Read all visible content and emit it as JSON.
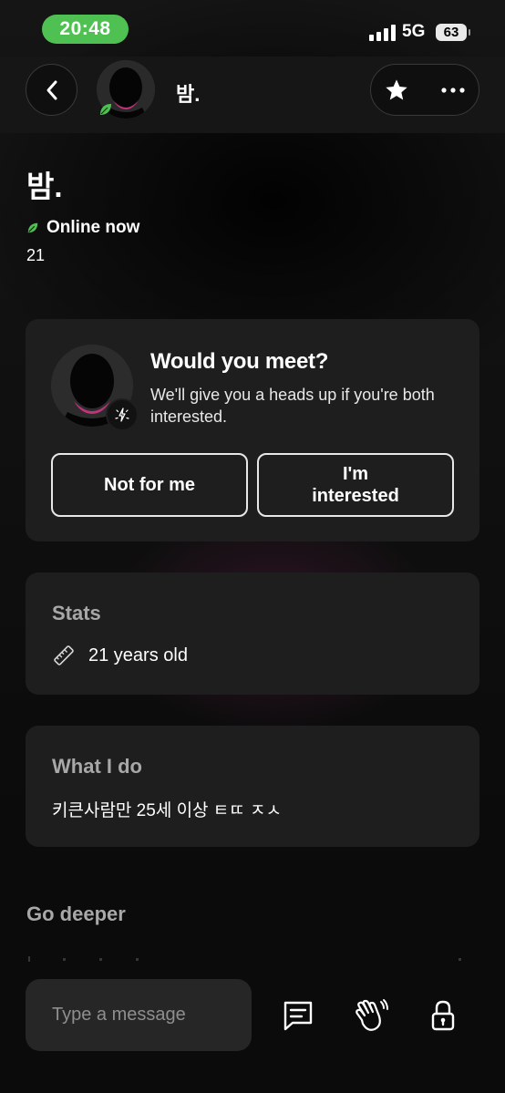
{
  "status_bar": {
    "time": "20:48",
    "network": "5G",
    "battery": "63"
  },
  "header": {
    "name": "밤."
  },
  "profile": {
    "name": "밤.",
    "online_status": "Online now",
    "age": "21"
  },
  "meet_card": {
    "title": "Would you meet?",
    "subtitle": "We'll give you a heads up if you're both interested.",
    "decline_label": "Not for me",
    "accept_label": "I'm interested"
  },
  "stats": {
    "heading": "Stats",
    "age_text": "21 years old"
  },
  "what_i_do": {
    "heading": "What I do",
    "text": "키큰사람만 25세 이상 ㅌㄸ ㅈㅅ"
  },
  "go_deeper": {
    "heading": "Go deeper"
  },
  "message_bar": {
    "placeholder": "Type a message"
  },
  "icons": [
    "back-icon",
    "star-icon",
    "more-icon",
    "leaf-icon",
    "spark-icon",
    "ruler-icon",
    "chat-icon",
    "wave-hand-icon",
    "lock-icon"
  ],
  "colors": {
    "online_green": "#4fc152",
    "accent_pink": "#c2327a",
    "card_bg": "#1e1e1e"
  }
}
